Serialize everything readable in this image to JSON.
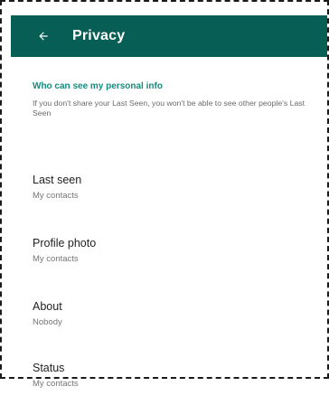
{
  "appbar": {
    "title": "Privacy",
    "back_icon": "arrow-left-icon",
    "background_color": "#075e54"
  },
  "section": {
    "header": "Who can see my personal info",
    "description": "If you don't share your Last Seen, you won't be able to see other people's Last Seen",
    "accent_color": "#128c7e"
  },
  "settings": [
    {
      "title": "Last seen",
      "value": "My contacts"
    },
    {
      "title": "Profile photo",
      "value": "My contacts"
    },
    {
      "title": "About",
      "value": "Nobody"
    },
    {
      "title": "Status",
      "value": "My contacts"
    }
  ]
}
